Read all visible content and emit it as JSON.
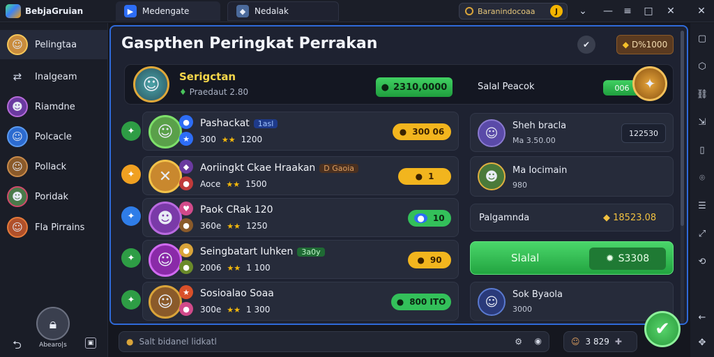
{
  "app": {
    "name": "BebjaGruian"
  },
  "tabs": [
    {
      "label": "Medengate",
      "icon": "app-icon"
    },
    {
      "label": "Nedalak",
      "icon": "game-icon"
    }
  ],
  "topbar": {
    "coins_text": "Baranindocoaa",
    "icon_badge": "J"
  },
  "sidebar": {
    "items": [
      {
        "label": "Pelingtaa",
        "icon": "avatar"
      },
      {
        "label": "Inalgeam",
        "icon": "swap-icon"
      },
      {
        "label": "Riamdne",
        "icon": "avatar"
      },
      {
        "label": "Polcacle",
        "icon": "avatar"
      },
      {
        "label": "Pollack",
        "icon": "avatar"
      },
      {
        "label": "Poridak",
        "icon": "avatar"
      },
      {
        "label": "Fla Pirrains",
        "icon": "avatar"
      }
    ],
    "lock_label": "Abearo|s"
  },
  "panel": {
    "title": "Gaspthen Peringkat Perrakan",
    "gem_value": "D%1000"
  },
  "me": {
    "name": "Serigctan",
    "sub": "Praedaut  2.80",
    "points": "2310,0000",
    "label": "Salal Peacok",
    "small_value": "006"
  },
  "leaderboard": [
    {
      "name": "Pashackat",
      "tag": "1asl",
      "stat1": "300",
      "stat2": "1200",
      "pill": "300 06",
      "rank_color": "#2e9d45"
    },
    {
      "name": "Aoriingkt Ckae Hraakan",
      "tag": "D Gaoia",
      "stat1": "Aoce",
      "stat2": "1500",
      "pill": "1",
      "rank_color": "#f0a021"
    },
    {
      "name": "Paok CRak 120",
      "tag": "",
      "stat1": "360e",
      "stat2": "1250",
      "pill": "10",
      "rank_color": "#2f7de8"
    },
    {
      "name": "Seingbatart Iuhken",
      "tag": "3a0y",
      "stat1": "2006",
      "stat2": "1 100",
      "pill": "90",
      "rank_color": "#2e9d45"
    },
    {
      "name": "Sosioalao Soaa",
      "tag": "",
      "stat1": "300e",
      "stat2": "1 300",
      "pill": "800 ITO",
      "rank_color": "#2e9d45"
    }
  ],
  "right": [
    {
      "name": "Sheh bracla",
      "sub": "Ma 3.50.00",
      "value": "122530"
    },
    {
      "name": "Ma Iocimain",
      "sub": "980"
    },
    {
      "name": "Palgamnda",
      "value": "18523.08"
    },
    {
      "name": "Sok Byaola",
      "sub": "3000"
    }
  ],
  "green_button": {
    "label": "Slalal",
    "value": "S3308"
  },
  "chat": {
    "placeholder": "Salt bidanel lidkatl",
    "score": "3 829"
  }
}
